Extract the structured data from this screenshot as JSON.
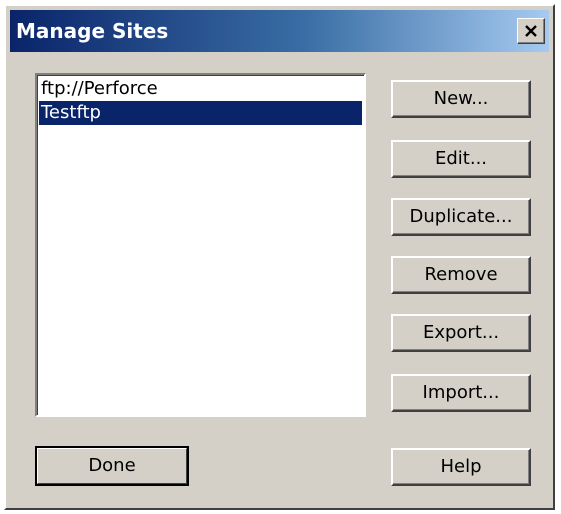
{
  "window": {
    "title": "Manage Sites"
  },
  "sites": {
    "items": [
      {
        "label": "ftp://Perforce",
        "selected": false
      },
      {
        "label": "Testftp",
        "selected": true
      }
    ]
  },
  "buttons": {
    "new": "New...",
    "edit": "Edit...",
    "duplicate": "Duplicate...",
    "remove": "Remove",
    "export": "Export...",
    "import": "Import...",
    "done": "Done",
    "help": "Help"
  },
  "colors": {
    "selection": "#0a246a",
    "title_start": "#0a246a",
    "title_end": "#a6caf0",
    "face": "#d4d0c8"
  },
  "icons": {
    "close": "close-icon"
  }
}
